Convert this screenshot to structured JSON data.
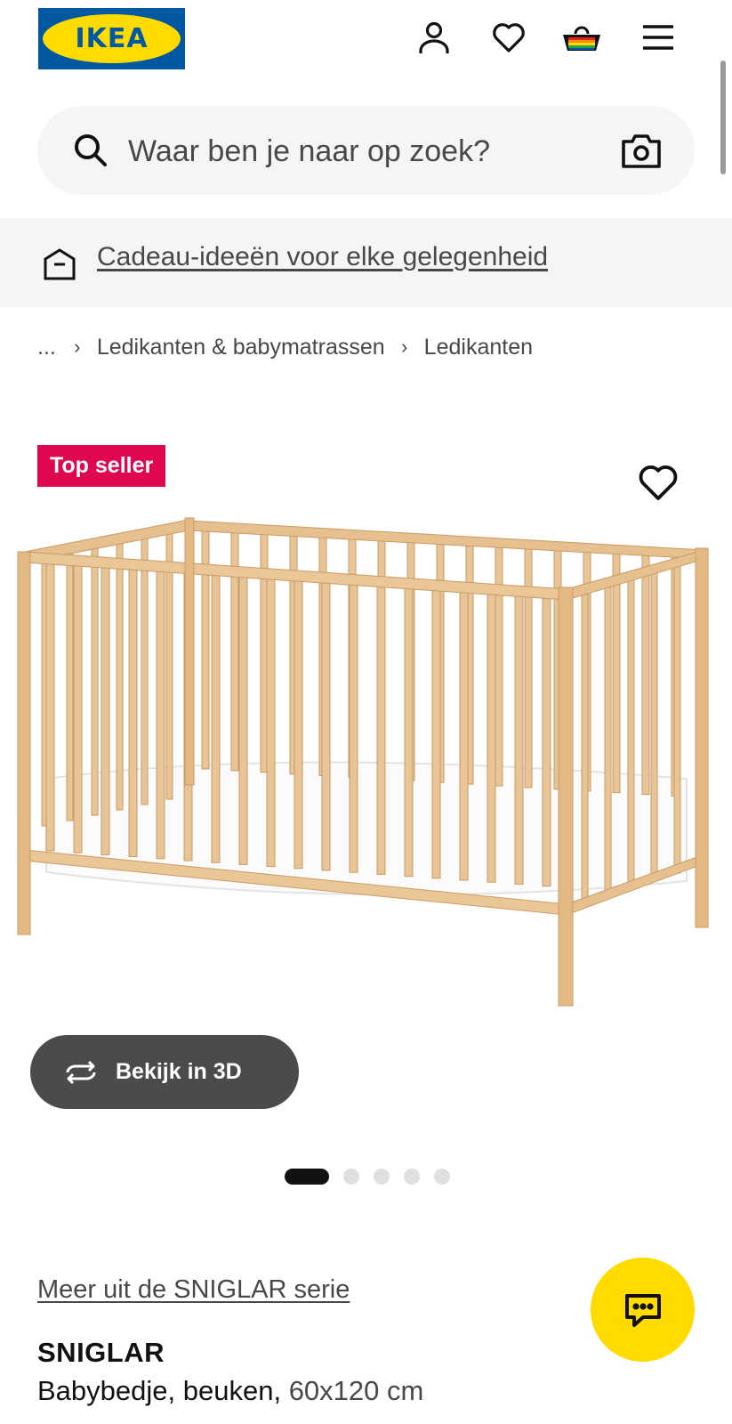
{
  "header": {
    "logo_text": "IKEA",
    "icons": [
      "user-icon",
      "heart-icon",
      "basket-icon",
      "menu-icon"
    ]
  },
  "search": {
    "placeholder": "Waar ben je naar op zoek?",
    "value": "",
    "icons": [
      "search-icon",
      "camera-icon"
    ]
  },
  "promo": {
    "label": "Cadeau-ideeën voor elke gelegenheid",
    "icon": "gift-box-icon"
  },
  "breadcrumb": {
    "ellipsis": "...",
    "separator": "›",
    "items": [
      "Ledikanten & babymatrassen",
      "Ledikanten"
    ]
  },
  "product": {
    "badge": "Top seller",
    "view_3d_label": "Bekijk in 3D",
    "image_alt": "crib-image",
    "carousel": {
      "total": 5,
      "active": 0
    },
    "series_link": "Meer uit de SNIGLAR serie",
    "name": "SNIGLAR",
    "description": "Babybedje, beuken,",
    "dimensions": "60x120 cm"
  },
  "colors": {
    "brand_blue": "#0058a3",
    "brand_yellow": "#ffdb00",
    "badge_red": "#e00751"
  }
}
